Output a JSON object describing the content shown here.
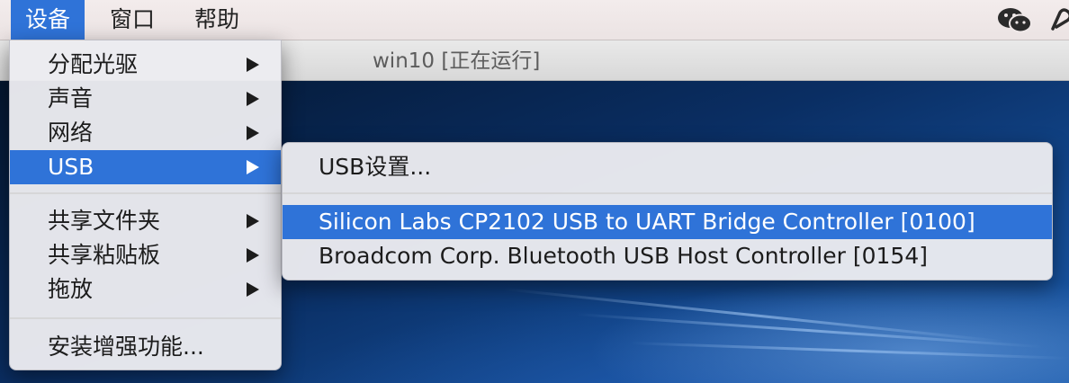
{
  "menubar": {
    "items": [
      {
        "label": "设备",
        "active": true
      },
      {
        "label": "窗口",
        "active": false
      },
      {
        "label": "帮助",
        "active": false
      }
    ],
    "right_icons": [
      "wechat-icon",
      "app-icon"
    ]
  },
  "window": {
    "title": "win10 [正在运行]"
  },
  "device_menu": {
    "items": [
      {
        "label": "分配光驱",
        "has_submenu": true
      },
      {
        "label": "声音",
        "has_submenu": true
      },
      {
        "label": "网络",
        "has_submenu": true
      },
      {
        "label": "USB",
        "has_submenu": true,
        "selected": true
      },
      {
        "label": "共享文件夹",
        "has_submenu": true
      },
      {
        "label": "共享粘贴板",
        "has_submenu": true
      },
      {
        "label": "拖放",
        "has_submenu": true
      },
      {
        "label": "安装增强功能...",
        "has_submenu": false
      }
    ]
  },
  "usb_submenu": {
    "settings_label": "USB设置...",
    "devices": [
      {
        "label": "Silicon Labs CP2102 USB to UART Bridge Controller [0100]",
        "selected": true
      },
      {
        "label": "Broadcom Corp. Bluetooth USB Host Controller [0154]",
        "selected": false
      }
    ]
  },
  "colors": {
    "accent": "#2f73d8",
    "menu_bg": "#ececf0"
  }
}
